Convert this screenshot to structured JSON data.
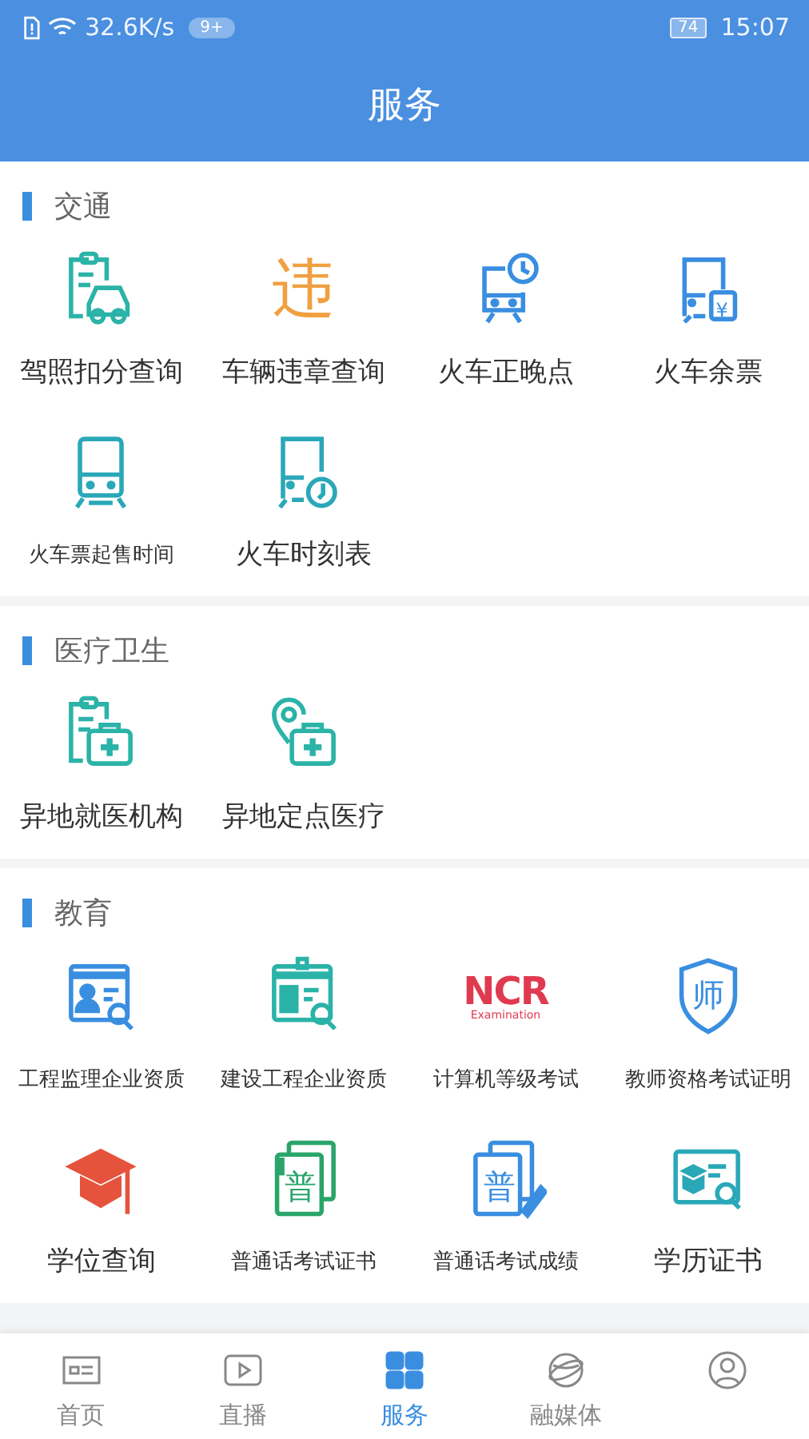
{
  "status_bar": {
    "speed": "32.6K/s",
    "notification_badge": "9+",
    "battery": "74",
    "time": "15:07"
  },
  "header": {
    "title": "服务"
  },
  "sections": [
    {
      "title": "交通",
      "items": [
        {
          "label": "驾照扣分查询"
        },
        {
          "label": "车辆违章查询",
          "glyph": "违"
        },
        {
          "label": "火车正晚点"
        },
        {
          "label": "火车余票",
          "glyph": "¥"
        },
        {
          "label": "火车票起售时间"
        },
        {
          "label": "火车时刻表"
        }
      ]
    },
    {
      "title": "医疗卫生",
      "items": [
        {
          "label": "异地就医机构"
        },
        {
          "label": "异地定点医疗"
        }
      ]
    },
    {
      "title": "教育",
      "items": [
        {
          "label": "工程监理企业资质"
        },
        {
          "label": "建设工程企业资质"
        },
        {
          "label": "计算机等级考试",
          "glyph": "NCR",
          "subglyph": "Examination"
        },
        {
          "label": "教师资格考试证明",
          "glyph": "师"
        },
        {
          "label": "学位查询"
        },
        {
          "label": "普通话考试证书",
          "glyph": "普"
        },
        {
          "label": "普通话考试成绩",
          "glyph": "普"
        },
        {
          "label": "学历证书"
        }
      ]
    }
  ],
  "tabs": [
    {
      "label": "首页",
      "selected": false
    },
    {
      "label": "直播",
      "selected": false
    },
    {
      "label": "服务",
      "selected": true
    },
    {
      "label": "融媒体",
      "selected": false
    },
    {
      "selected": false
    }
  ]
}
